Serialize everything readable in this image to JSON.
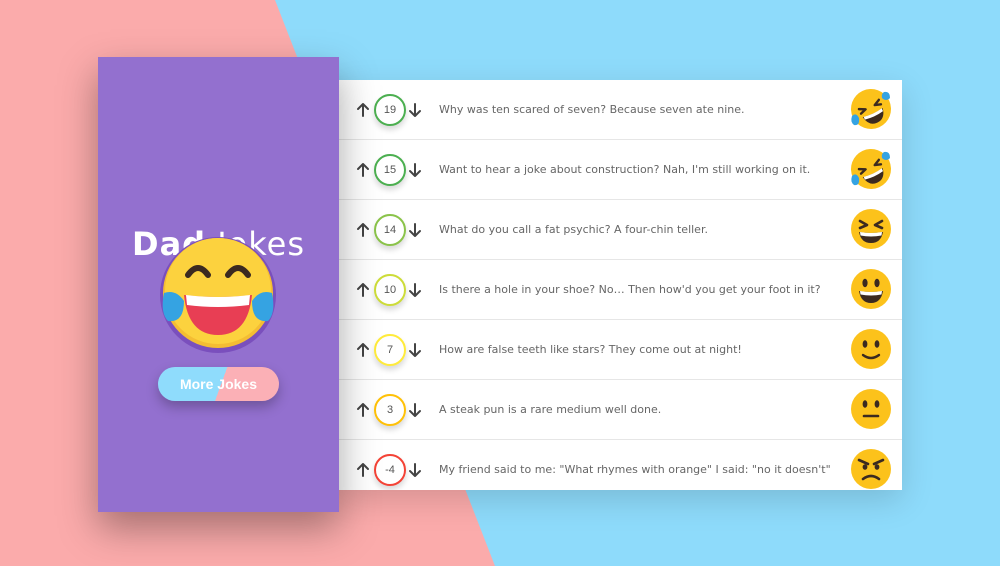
{
  "app": {
    "title_bold": "Dad",
    "title_light": "Jokes",
    "more_button": "More Jokes"
  },
  "colors": {
    "bg_pink": "#fbabab",
    "bg_blue": "#8edbfb",
    "sidebar": "#9370cf",
    "vote_green": "#4caf50",
    "vote_lime": "#8bc34a",
    "vote_yellowgreen": "#cddc39",
    "vote_yellow": "#ffeb3b",
    "vote_orange": "#ffc107",
    "vote_red": "#f44336"
  },
  "jokes": [
    {
      "votes": "19",
      "text": "Why was ten scared of seven? Because seven ate nine.",
      "emoji": "rolling-laughing",
      "color": "#4caf50"
    },
    {
      "votes": "15",
      "text": "Want to hear a joke about construction? Nah, I'm still working on it.",
      "emoji": "rolling-laughing",
      "color": "#4caf50"
    },
    {
      "votes": "14",
      "text": "What do you call a fat psychic? A four-chin teller.",
      "emoji": "grinning-squint",
      "color": "#8bc34a"
    },
    {
      "votes": "10",
      "text": "Is there a hole in your shoe? No… Then how'd you get your foot in it?",
      "emoji": "grinning-big-eyes",
      "color": "#cddc39"
    },
    {
      "votes": "7",
      "text": "How are false teeth like stars? They come out at night!",
      "emoji": "slight-smile",
      "color": "#ffeb3b"
    },
    {
      "votes": "3",
      "text": "A steak pun is a rare medium well done.",
      "emoji": "neutral",
      "color": "#ffc107"
    },
    {
      "votes": "-4",
      "text": "My friend said to me: \"What rhymes with orange\" I said: \"no it doesn't\"",
      "emoji": "angry",
      "color": "#f44336"
    }
  ]
}
